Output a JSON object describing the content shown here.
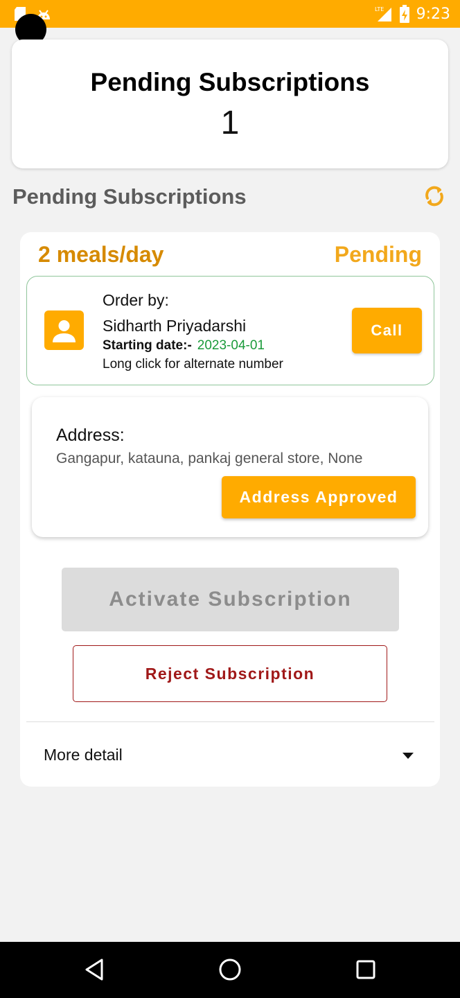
{
  "status_bar": {
    "time": "9:23",
    "network": "LTE",
    "accent_color": "#ffab00",
    "icons": [
      "sd-card-icon",
      "android-icon",
      "lte-signal-icon",
      "battery-charging-icon"
    ]
  },
  "summary": {
    "title": "Pending Subscriptions",
    "count": "1"
  },
  "section": {
    "heading": "Pending Subscriptions",
    "refresh_icon": "refresh-icon"
  },
  "subscription": {
    "plan": "2 meals/day",
    "status": "Pending",
    "order": {
      "label": "Order by:",
      "customer_name": "Sidharth Priyadarshi",
      "start_label": "Starting date:-",
      "start_date": "2023-04-01",
      "hint": "Long click for alternate number",
      "call_label": "Call",
      "avatar_icon": "person-avatar-icon"
    },
    "address": {
      "label": "Address:",
      "text": "Gangapur, katauna, pankaj general store, None",
      "approved_label": "Address Approved"
    },
    "activate_label": "Activate Subscription",
    "reject_label": "Reject Subscription",
    "more_detail_label": "More detail"
  },
  "colors": {
    "primary": "#ffab00",
    "plan_text": "#d68a00",
    "status_text": "#f2a81c",
    "date_green": "#1a9a3a",
    "reject_red": "#a01818",
    "disabled_bg": "#dcdcdc"
  },
  "nav_bar": {
    "icons": [
      "back-icon",
      "home-icon",
      "recents-icon"
    ]
  }
}
